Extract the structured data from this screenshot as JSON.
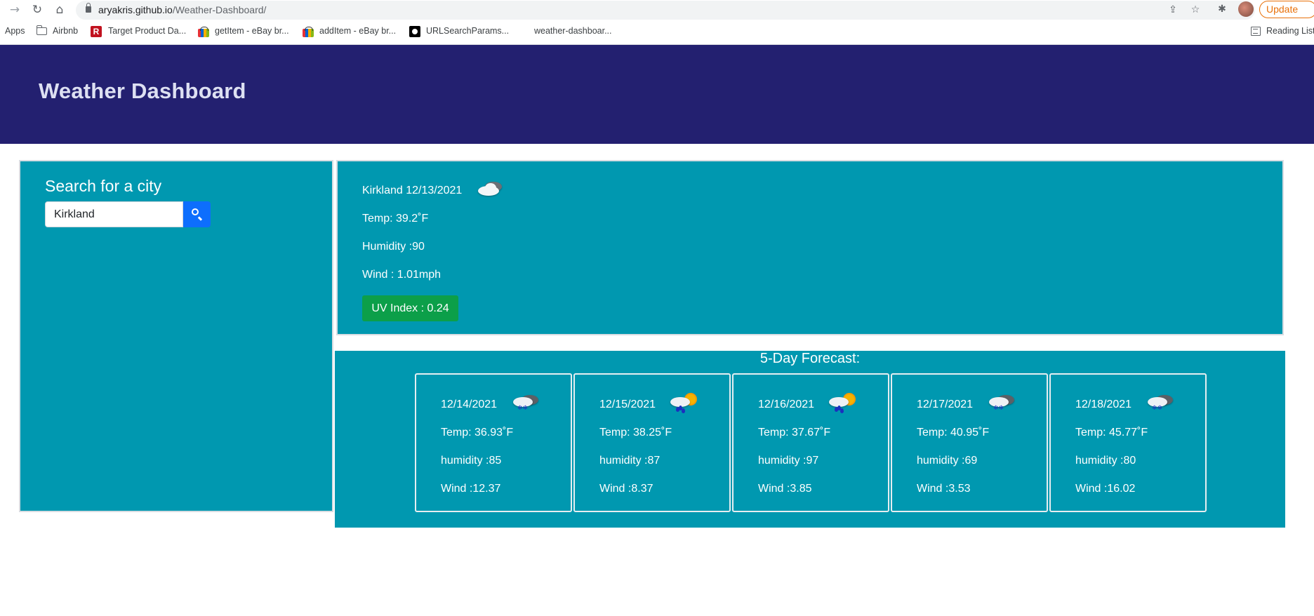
{
  "browser": {
    "url_host": "aryakris.github.io",
    "url_path": "/Weather-Dashboard/",
    "update_label": "Update",
    "bookmarks": [
      {
        "label": "Apps",
        "icon": "apps"
      },
      {
        "label": "Airbnb",
        "icon": "folder-icon"
      },
      {
        "label": "Target Product Da...",
        "icon": "target-r-icon"
      },
      {
        "label": "getItem - eBay br...",
        "icon": "ebay-icon"
      },
      {
        "label": "addItem - eBay br...",
        "icon": "ebay-icon"
      },
      {
        "label": "URLSearchParams...",
        "icon": "github-icon"
      },
      {
        "label": "weather-dashboar...",
        "icon": "none"
      }
    ],
    "reading_list_label": "Reading List"
  },
  "header": {
    "title": "Weather Dashboard",
    "background": "#232070"
  },
  "search": {
    "title": "Search for a city",
    "input_value": "Kirkland"
  },
  "current": {
    "city_date": "Kirkland 12/13/2021",
    "icon": "cloudy-night-icon",
    "temp": "Temp: 39.2˚F",
    "humidity": "Humidity :90",
    "wind": "Wind : 1.01mph",
    "uv": "UV Index : 0.24",
    "uv_color": "#0c9f49"
  },
  "forecast": {
    "title": "5-Day Forecast:",
    "days": [
      {
        "date": "12/14/2021",
        "icon": "snow-cloud-icon",
        "temp": "Temp: 36.93˚F",
        "humidity": "humidity :85",
        "wind": "Wind :12.37"
      },
      {
        "date": "12/15/2021",
        "icon": "rain-sun-icon",
        "temp": "Temp: 38.25˚F",
        "humidity": "humidity :87",
        "wind": "Wind :8.37"
      },
      {
        "date": "12/16/2021",
        "icon": "rain-sun-icon",
        "temp": "Temp: 37.67˚F",
        "humidity": "humidity :97",
        "wind": "Wind :3.85"
      },
      {
        "date": "12/17/2021",
        "icon": "snow-cloud-icon",
        "temp": "Temp: 40.95˚F",
        "humidity": "humidity :69",
        "wind": "Wind :3.53"
      },
      {
        "date": "12/18/2021",
        "icon": "snow-cloud-icon",
        "temp": "Temp: 45.77˚F",
        "humidity": "humidity :80",
        "wind": "Wind :16.02"
      }
    ]
  },
  "colors": {
    "panel": "#0098b0",
    "search_button": "#0d6efd"
  }
}
